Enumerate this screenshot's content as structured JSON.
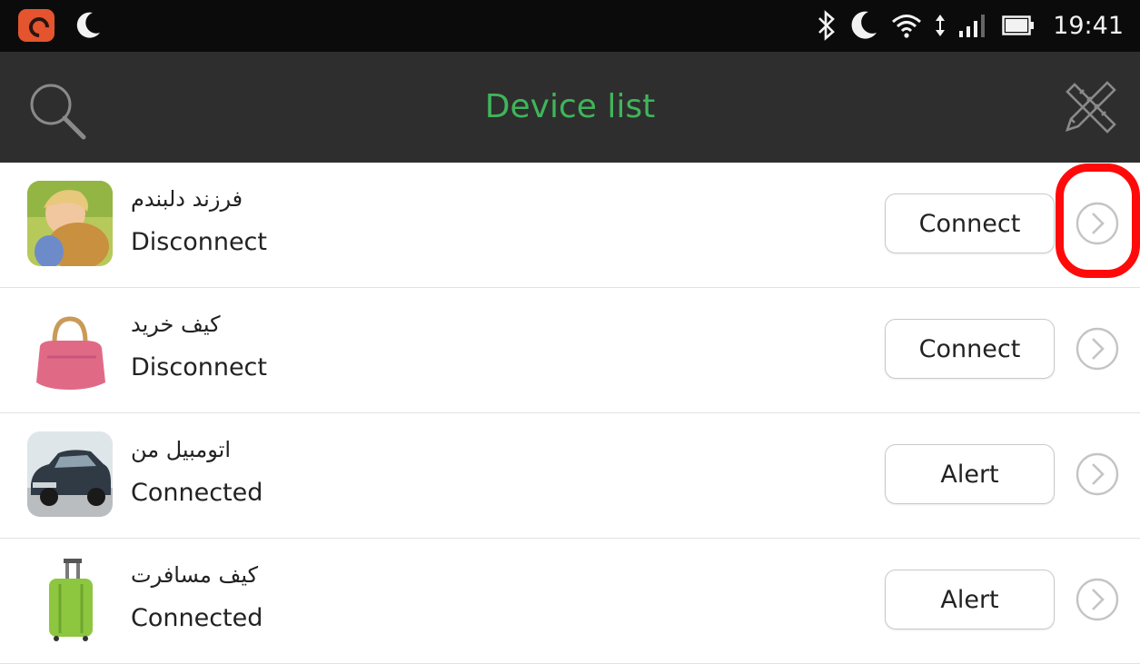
{
  "status_bar": {
    "time": "19:41",
    "left_icons": [
      "app-badge-icon",
      "moon-icon"
    ],
    "right_icons": [
      "bluetooth-icon",
      "moon-icon",
      "wifi-icon",
      "data-arrows-icon",
      "signal-icon",
      "battery-icon"
    ]
  },
  "app_bar": {
    "title": "Device list",
    "title_color": "#3fb55a",
    "left_icon": "search-icon",
    "right_icon": "tools-icon"
  },
  "devices": [
    {
      "name": "فرزند دلبندم",
      "status": "Disconnect",
      "action": "Connect",
      "thumb": "child-photo"
    },
    {
      "name": "کیف خرید",
      "status": "Disconnect",
      "action": "Connect",
      "thumb": "handbag-photo"
    },
    {
      "name": "اتومبیل من",
      "status": "Connected",
      "action": "Alert",
      "thumb": "car-photo"
    },
    {
      "name": "کیف مسافرت",
      "status": "Connected",
      "action": "Alert",
      "thumb": "suitcase-photo"
    }
  ],
  "annotation": {
    "color": "#ff0a0a",
    "target": "first row chevron"
  }
}
